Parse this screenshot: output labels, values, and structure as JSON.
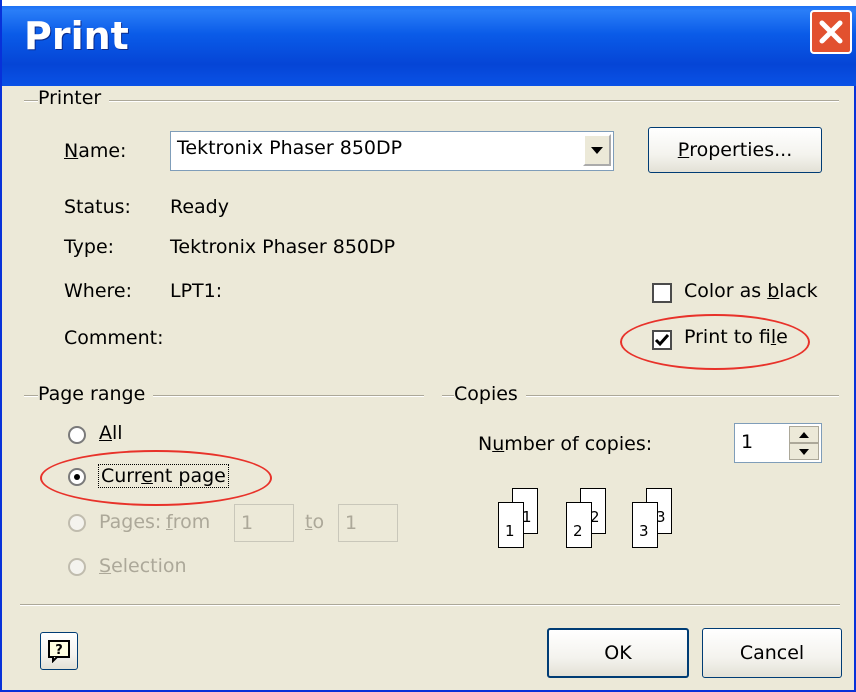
{
  "window": {
    "title": "Print"
  },
  "printer": {
    "group_label": "Printer",
    "name_label_pre": "",
    "name_label_u": "N",
    "name_label_post": "ame:",
    "name_value": "Tektronix Phaser 850DP",
    "properties_u": "P",
    "properties_post": "roperties...",
    "status_label": "Status:",
    "status_value": "Ready",
    "type_label": "Type:",
    "type_value": "Tektronix Phaser 850DP",
    "where_label": "Where:",
    "where_value": "LPT1:",
    "comment_label": "Comment:",
    "color_as_black_pre": "Color as ",
    "color_as_black_u": "b",
    "color_as_black_post": "lack",
    "color_as_black_checked": false,
    "print_to_file_pre": "Print to fi",
    "print_to_file_u": "l",
    "print_to_file_post": "e",
    "print_to_file_checked": true
  },
  "page_range": {
    "group_label": "Page range",
    "all_u": "A",
    "all_post": "ll",
    "current_pre": "Curr",
    "current_u": "e",
    "current_post": "nt page",
    "pages_pre": "Pa",
    "pages_u": "g",
    "pages_post": "es:",
    "from_u": "f",
    "from_post": "rom",
    "from_value": "1",
    "to_u": "t",
    "to_post": "o",
    "to_value": "1",
    "selection_u": "S",
    "selection_post": "election",
    "selected": "current"
  },
  "copies": {
    "group_label": "Copies",
    "number_pre": "N",
    "number_u": "u",
    "number_post": "mber of copies:",
    "number_value": "1",
    "collate_labels": [
      "1",
      "1",
      "2",
      "2",
      "3",
      "3"
    ]
  },
  "footer": {
    "help_icon": "help-icon",
    "ok_label": "OK",
    "cancel_label": "Cancel"
  },
  "colors": {
    "titlebar": "#0a5be8",
    "annotation": "#e8322a",
    "face": "#ece9d8"
  }
}
